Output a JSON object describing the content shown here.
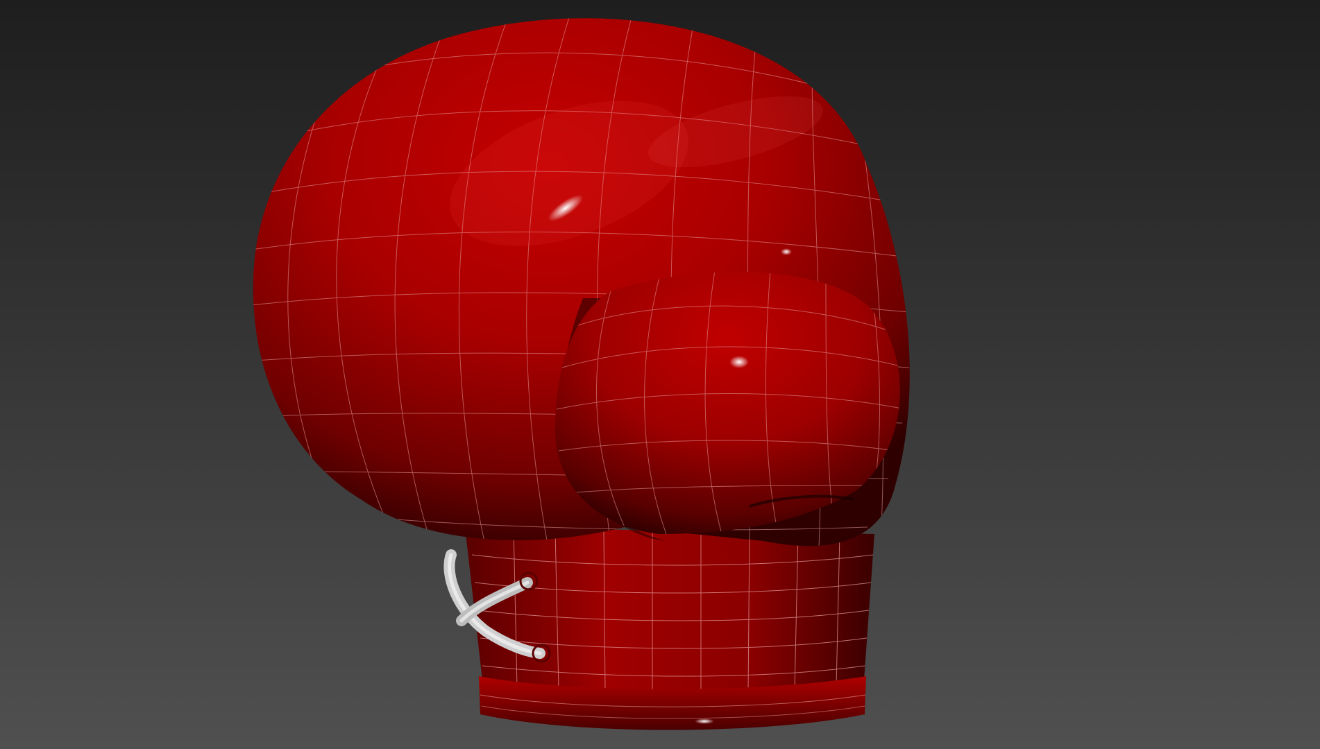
{
  "viewport": {
    "background_top": "#1e1e1e",
    "background_bottom": "#505050",
    "model": {
      "object": "boxing-glove",
      "shading": "smooth-shaded-with-wireframe",
      "surface_color": "#b20000",
      "surface_highlight": "#e02020",
      "surface_shadow": "#3a0000",
      "wire_color": "#e8a0a0",
      "lace_color": "#d8d8d8"
    }
  }
}
